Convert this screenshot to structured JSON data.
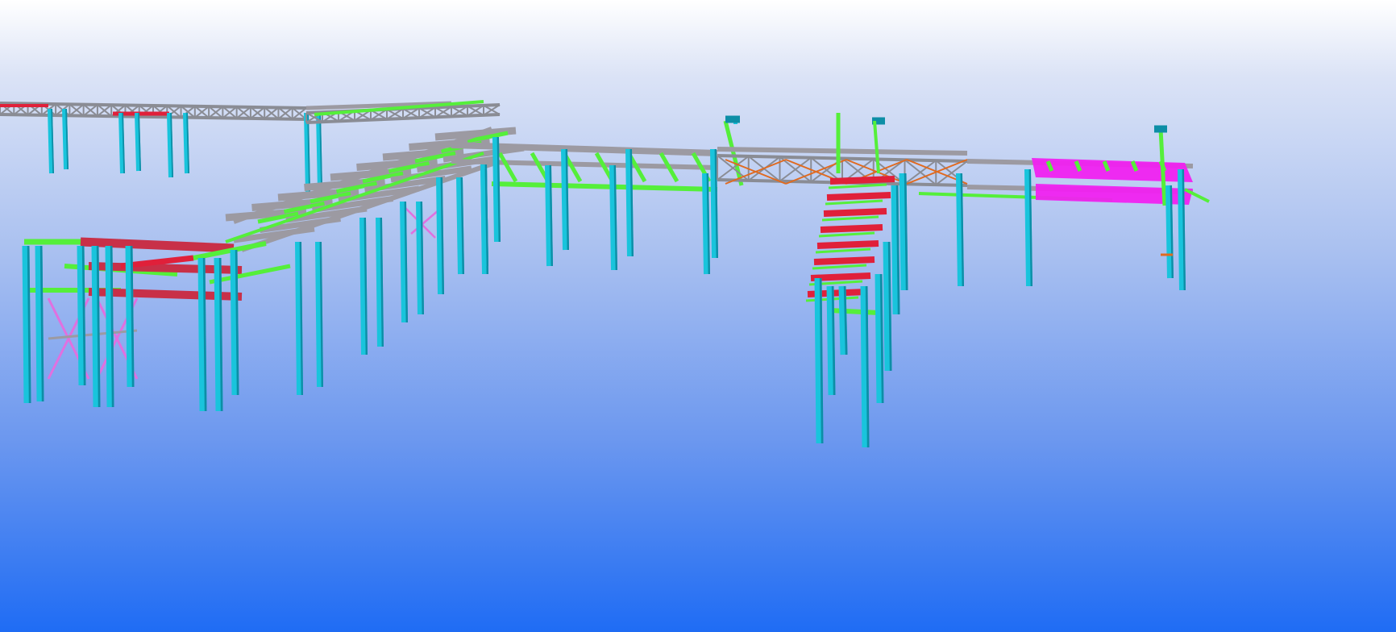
{
  "viewport": {
    "label": "",
    "background_top": "#ffffff",
    "background_bottom": "#1f6cf4"
  },
  "model": {
    "type": "3d-steel-structure-pipe-rack",
    "member_colors": {
      "column": "#19c4dc",
      "column_shade": "#0d8ea6",
      "beam_green": "#55ef3a",
      "beam_gray": "#9c9aa2",
      "beam_red": "#e0203a",
      "beam_dark_red": "#c83048",
      "beam_magenta": "#f021f0",
      "bracing_pink": "#e070e0",
      "bracing_orange": "#e06a20",
      "truss_gray": "#8a8c94"
    }
  }
}
